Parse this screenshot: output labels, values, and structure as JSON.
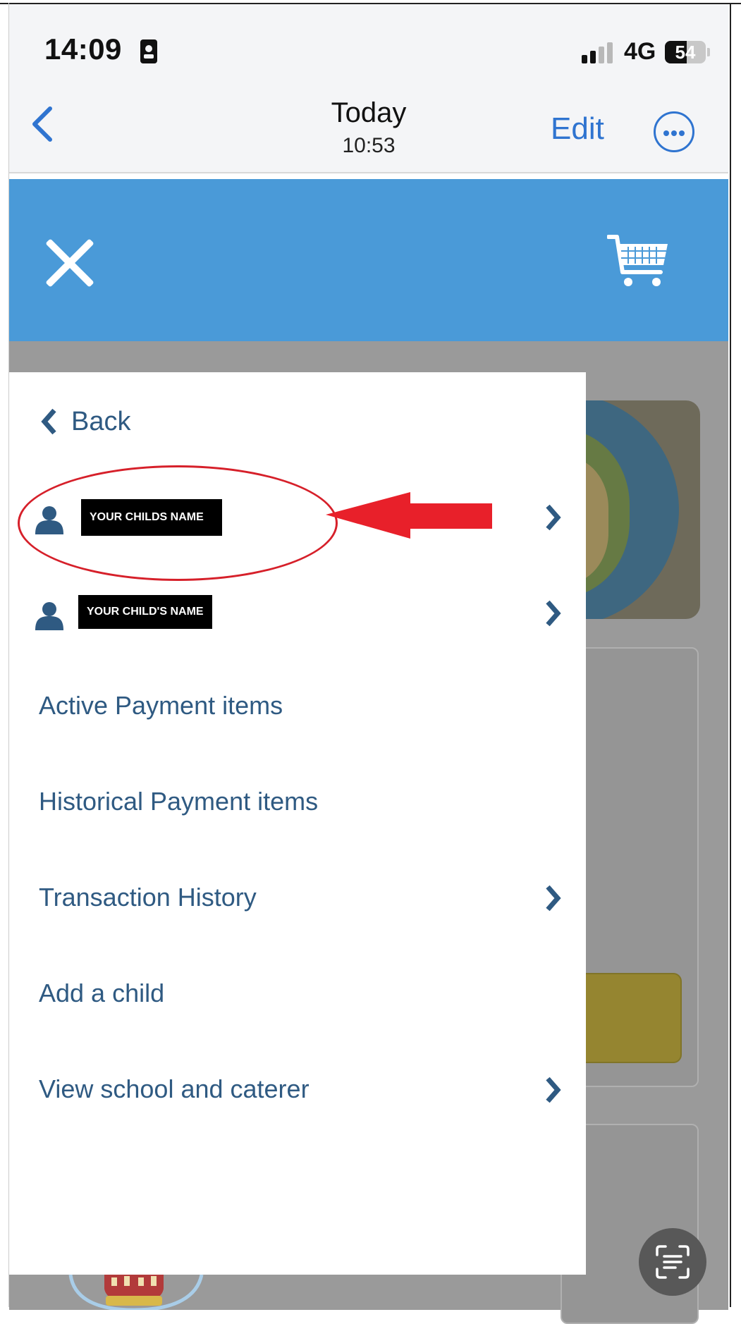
{
  "status_bar": {
    "time": "14:09",
    "network": "4G",
    "battery": "54"
  },
  "nav_bar": {
    "title": "Today",
    "subtitle": "10:53",
    "edit_label": "Edit"
  },
  "drawer": {
    "back_label": "Back",
    "children": [
      {
        "name": "YOUR CHILDS NAME"
      },
      {
        "name": "YOUR CHILD'S NAME"
      }
    ],
    "menu_items": [
      {
        "label": "Active Payment items",
        "has_chevron": false
      },
      {
        "label": "Historical Payment items",
        "has_chevron": false
      },
      {
        "label": "Transaction History",
        "has_chevron": true
      },
      {
        "label": "Add a child",
        "has_chevron": false
      },
      {
        "label": "View school and caterer",
        "has_chevron": true
      }
    ]
  },
  "colors": {
    "header_blue": "#4a9ad8",
    "ios_blue": "#2f74d0",
    "menu_text": "#2f5a82",
    "annotation_red": "#d6202a",
    "overlay_grey": "#9a9a9a"
  },
  "icons": [
    "chevron-left-icon",
    "more-icon",
    "close-icon",
    "cart-icon",
    "person-icon",
    "chevron-right-icon",
    "scan-text-icon"
  ]
}
